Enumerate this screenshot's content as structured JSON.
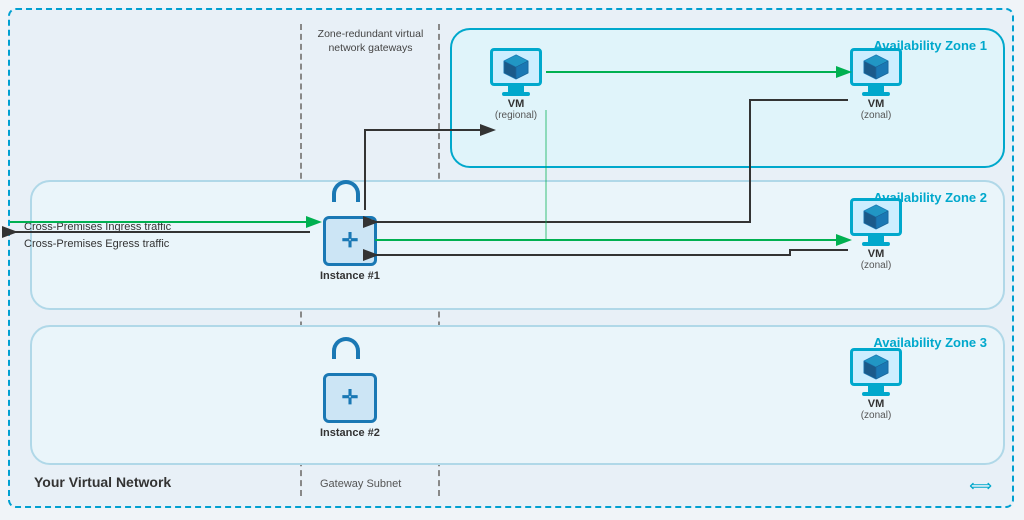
{
  "diagram": {
    "outerLabel": "Your Virtual Network",
    "gatewaySubnetLabel": "Gateway Subnet",
    "zoneRedundantLabel": "Zone-redundant virtual network gateways",
    "zones": [
      {
        "id": "zone1",
        "label": "Availability Zone 1"
      },
      {
        "id": "zone2",
        "label": "Availability Zone 2"
      },
      {
        "id": "zone3",
        "label": "Availability Zone 3"
      }
    ],
    "vms": [
      {
        "id": "vm-regional",
        "label": "VM",
        "sublabel": "(regional)"
      },
      {
        "id": "vm-zone1",
        "label": "VM",
        "sublabel": "(zonal)"
      },
      {
        "id": "vm-zone2",
        "label": "VM",
        "sublabel": "(zonal)"
      },
      {
        "id": "vm-zone3",
        "label": "VM",
        "sublabel": "(zonal)"
      }
    ],
    "instances": [
      {
        "id": "instance1",
        "label": "Instance #1"
      },
      {
        "id": "instance2",
        "label": "Instance #2"
      }
    ],
    "traffic": [
      {
        "id": "ingress",
        "label": "Cross-Premises Ingress traffic"
      },
      {
        "id": "egress",
        "label": "Cross-Premises Egress traffic"
      }
    ],
    "navIcon": "⟺"
  }
}
